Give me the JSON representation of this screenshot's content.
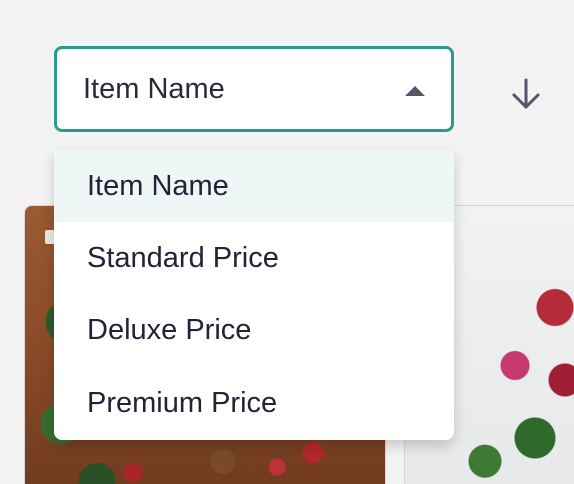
{
  "sort": {
    "selected_label": "Item Name",
    "options": [
      {
        "label": "Item Name",
        "selected": true
      },
      {
        "label": "Standard Price",
        "selected": false
      },
      {
        "label": "Deluxe Price",
        "selected": false
      },
      {
        "label": "Premium Price",
        "selected": false
      }
    ],
    "direction_icon": "arrow-down-icon",
    "caret_icon": "caret-up-icon"
  },
  "colors": {
    "accent": "#2b9c8c",
    "selected_bg": "#eef7f5",
    "text": "#232338"
  }
}
